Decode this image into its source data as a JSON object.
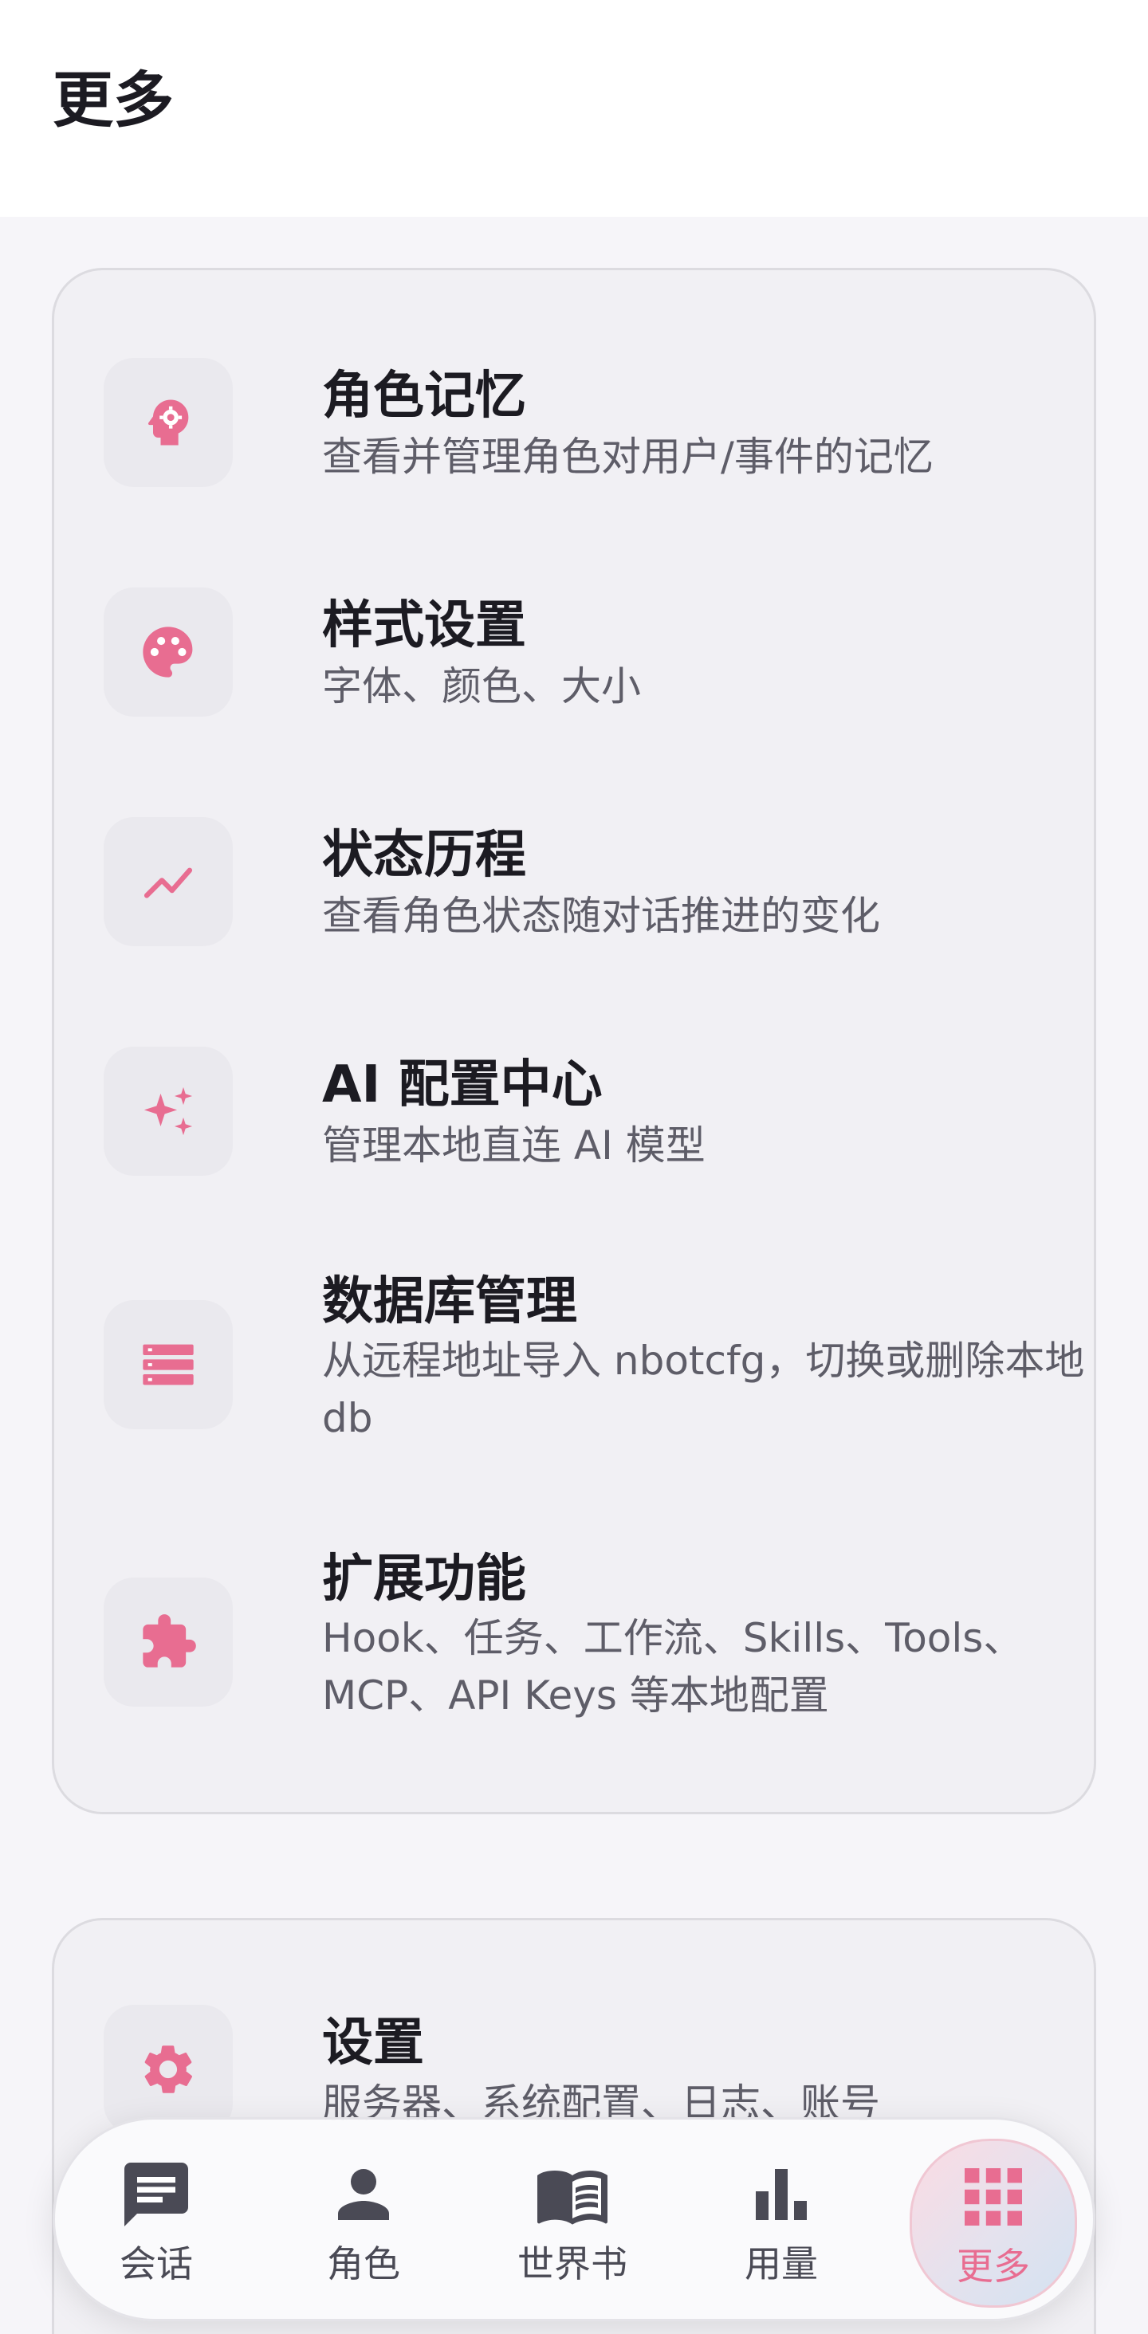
{
  "header": {
    "title": "更多"
  },
  "colors": {
    "accent": "#e86d91",
    "icon_dark": "#4a4a55"
  },
  "menu": [
    {
      "icon": "head-gear-icon",
      "title": "角色记忆",
      "desc": "查看并管理角色对用户/事件的记忆"
    },
    {
      "icon": "palette-icon",
      "title": "样式设置",
      "desc": "字体、颜色、大小"
    },
    {
      "icon": "trend-icon",
      "title": "状态历程",
      "desc": "查看角色状态随对话推进的变化"
    },
    {
      "icon": "sparkle-icon",
      "title": "AI 配置中心",
      "desc": "管理本地直连 AI 模型"
    },
    {
      "icon": "database-icon",
      "title": "数据库管理",
      "desc": "从远程地址导入 nbotcfg，切换或删除本地 db"
    },
    {
      "icon": "puzzle-icon",
      "title": "扩展功能",
      "desc": "Hook、任务、工作流、Skills、Tools、MCP、API Keys 等本地配置"
    }
  ],
  "settings": {
    "icon": "gear-icon",
    "title": "设置",
    "desc": "服务器、系统配置、日志、账号"
  },
  "nav": [
    {
      "icon": "chat-icon",
      "label": "会话",
      "active": false
    },
    {
      "icon": "person-icon",
      "label": "角色",
      "active": false
    },
    {
      "icon": "book-icon",
      "label": "世界书",
      "active": false
    },
    {
      "icon": "bar-chart-icon",
      "label": "用量",
      "active": false
    },
    {
      "icon": "grid-icon",
      "label": "更多",
      "active": true
    }
  ]
}
